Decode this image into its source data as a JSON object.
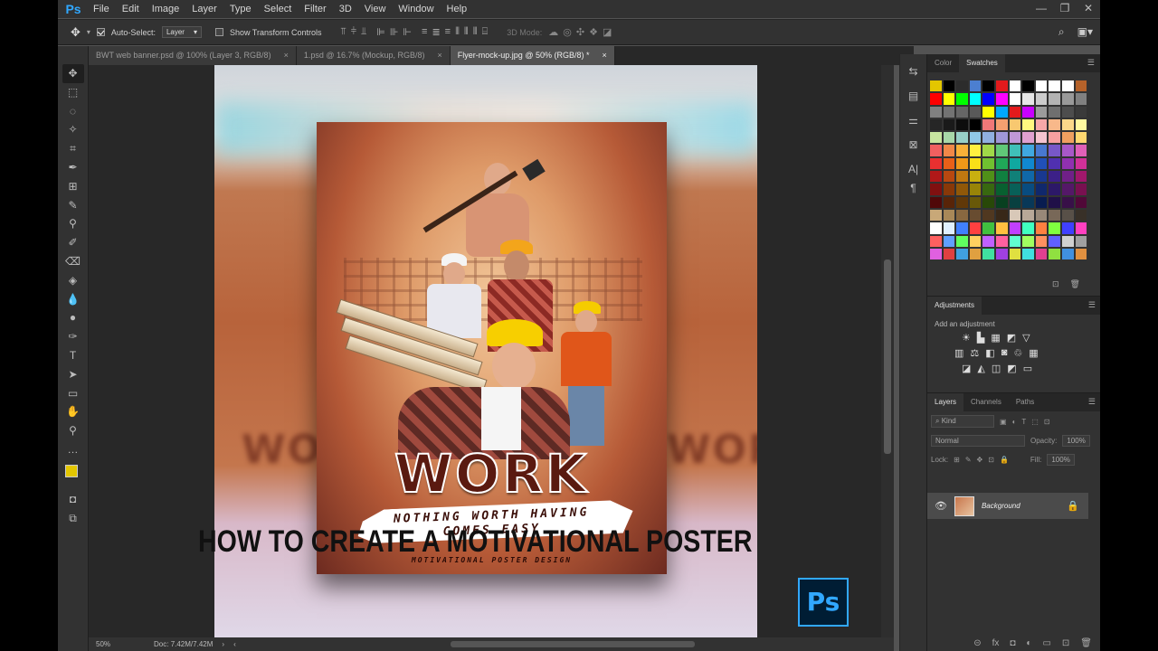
{
  "app": {
    "logo": "Ps"
  },
  "menu": [
    "File",
    "Edit",
    "Image",
    "Layer",
    "Type",
    "Select",
    "Filter",
    "3D",
    "View",
    "Window",
    "Help"
  ],
  "window_controls": {
    "min": "—",
    "max": "❐",
    "close": "✕"
  },
  "options": {
    "auto_select_label": "Auto-Select:",
    "auto_select_value": "Layer",
    "show_transform": "Show Transform Controls",
    "mode_3d": "3D Mode:"
  },
  "tabs": [
    {
      "label": "BWT web banner.psd @ 100% (Layer 3, RGB/8)",
      "close": "×"
    },
    {
      "label": "1.psd @ 16.7% (Mockup, RGB/8)",
      "close": "×"
    },
    {
      "label": "Flyer-mock-up.jpg @ 50% (RGB/8) *",
      "close": "×"
    }
  ],
  "poster": {
    "title": "WORK",
    "tagline1": "NOTHING WORTH HAVING",
    "tagline2": "COMES EASY",
    "subline": "MOTIVATIONAL POSTER DESIGN"
  },
  "caption": "HOW TO CREATE A MOTIVATIONAL POSTER",
  "badge": "Ps",
  "status": {
    "zoom": "50%",
    "doc": "Doc: 7.42M/7.42M"
  },
  "panels": {
    "color_tab": "Color",
    "swatches_tab": "Swatches",
    "adjustments_tab": "Adjustments",
    "add_adjustment": "Add an adjustment",
    "layers_tab": "Layers",
    "channels_tab": "Channels",
    "paths_tab": "Paths",
    "kind": "Kind",
    "blend": "Normal",
    "opacity_label": "Opacity:",
    "opacity": "100%",
    "lock_label": "Lock:",
    "fill_label": "Fill:",
    "fill": "100%",
    "layer_name": "Background"
  },
  "colors": {
    "foreground": "#e3c600",
    "background": "#000000",
    "swatches": [
      "#e3c600",
      "#000000",
      "#2c2c2c",
      "#4c7fd0",
      "#000000",
      "#e31a1c",
      "#ffffff",
      "#000000",
      "#ffffff",
      "#ffffff",
      "#ffffff",
      "#b5622a",
      "#ff0000",
      "#ffff00",
      "#00ff00",
      "#00ffff",
      "#0000ff",
      "#ff00ff",
      "#ffffff",
      "#e6e6e6",
      "#cccccc",
      "#b3b3b3",
      "#999999",
      "#808080",
      "#808080",
      "#737373",
      "#666666",
      "#595959",
      "#ffff00",
      "#00a8ff",
      "#e31a1c",
      "#c800ff",
      "#9b9b9b",
      "#6f6f6f",
      "#4d4d4d",
      "#3a3a3a",
      "#262626",
      "#1a1a1a",
      "#0d0d0d",
      "#000000",
      "#f07878",
      "#f5a070",
      "#f8c870",
      "#fff880",
      "#f7a8a8",
      "#f8b88a",
      "#fad88a",
      "#fff9a0",
      "#c8e6a0",
      "#a8d8a8",
      "#98d0c8",
      "#90c8e8",
      "#90b0e0",
      "#a098d8",
      "#c098d8",
      "#e0a0d0",
      "#f5c3d0",
      "#f7a0a0",
      "#f0a060",
      "#ffd870",
      "#f06060",
      "#f08848",
      "#f8b038",
      "#fff040",
      "#a0d848",
      "#60c878",
      "#40c0b8",
      "#40a8e0",
      "#4878d0",
      "#7858c8",
      "#a858c8",
      "#e060b8",
      "#e83030",
      "#e86018",
      "#f09818",
      "#f8e018",
      "#70c030",
      "#20a858",
      "#10a8a0",
      "#1088d0",
      "#2050b8",
      "#5030b0",
      "#9030b0",
      "#d03098",
      "#b01818",
      "#b84810",
      "#c07810",
      "#c8b010",
      "#509018",
      "#108040",
      "#108078",
      "#1068a8",
      "#183890",
      "#3c2088",
      "#702088",
      "#a0186c",
      "#801010",
      "#883808",
      "#905808",
      "#988408",
      "#386810",
      "#086030",
      "#086058",
      "#084c80",
      "#10286c",
      "#2c1868",
      "#541868",
      "#781050",
      "#500808",
      "#582408",
      "#603808",
      "#685808",
      "#284808",
      "#084020",
      "#084040",
      "#083858",
      "#081c50",
      "#201048",
      "#381048",
      "#500838",
      "#c8a878",
      "#a88858",
      "#886840",
      "#684c30",
      "#503820",
      "#382818",
      "#d8c8b8",
      "#b8a898",
      "#988878",
      "#786858",
      "#585048",
      "#383028",
      "#ffffff",
      "#e0f0ff",
      "#4080ff",
      "#ff4040",
      "#40c040",
      "#ffc040",
      "#c040ff",
      "#40ffc0",
      "#ff8040",
      "#80ff40",
      "#4040ff",
      "#ff40c0",
      "#ff6060",
      "#60a0ff",
      "#60ff60",
      "#ffd060",
      "#c060ff",
      "#ff60a0",
      "#60ffd0",
      "#a0ff60",
      "#ff9060",
      "#6060ff",
      "#d0d0d0",
      "#a0a0a0",
      "#e060e0",
      "#e04040",
      "#40a0e0",
      "#e0a040",
      "#40e0a0",
      "#a040e0",
      "#e0e040",
      "#40e0e0",
      "#e04090",
      "#90e040",
      "#4090e0",
      "#e09040"
    ]
  }
}
